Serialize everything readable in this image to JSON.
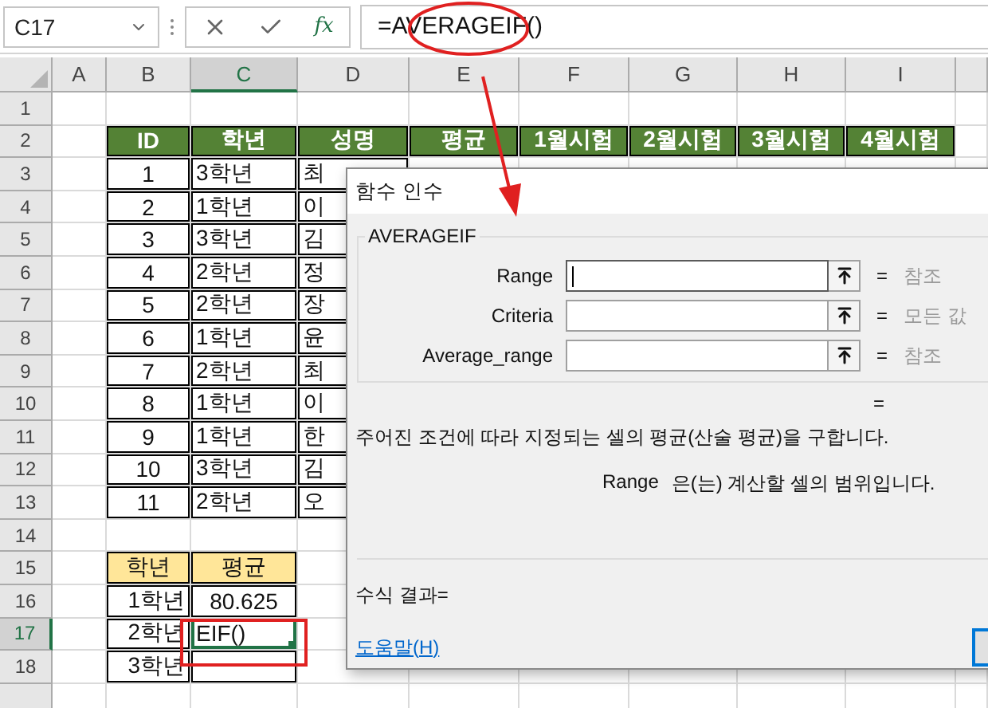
{
  "name_box": "C17",
  "function_button": "fx",
  "formula": "=AVERAGEIF()",
  "columns": [
    {
      "label": "A",
      "selected": false
    },
    {
      "label": "B",
      "selected": false
    },
    {
      "label": "C",
      "selected": true
    },
    {
      "label": "D",
      "selected": false
    },
    {
      "label": "E",
      "selected": false
    },
    {
      "label": "F",
      "selected": false
    },
    {
      "label": "G",
      "selected": false
    },
    {
      "label": "H",
      "selected": false
    },
    {
      "label": "I",
      "selected": false
    }
  ],
  "rows": [
    {
      "label": "1",
      "selected": false
    },
    {
      "label": "2",
      "selected": false
    },
    {
      "label": "3",
      "selected": false
    },
    {
      "label": "4",
      "selected": false
    },
    {
      "label": "5",
      "selected": false
    },
    {
      "label": "6",
      "selected": false
    },
    {
      "label": "7",
      "selected": false
    },
    {
      "label": "8",
      "selected": false
    },
    {
      "label": "9",
      "selected": false
    },
    {
      "label": "10",
      "selected": false
    },
    {
      "label": "11",
      "selected": false
    },
    {
      "label": "12",
      "selected": false
    },
    {
      "label": "13",
      "selected": false
    },
    {
      "label": "14",
      "selected": false
    },
    {
      "label": "15",
      "selected": false
    },
    {
      "label": "16",
      "selected": false
    },
    {
      "label": "17",
      "selected": true
    },
    {
      "label": "18",
      "selected": false
    }
  ],
  "main_table": {
    "columns": [
      "ID",
      "학년",
      "성명",
      "평균",
      "1월시험",
      "2월시험",
      "3월시험",
      "4월시험"
    ],
    "rows": [
      {
        "id": "1",
        "grade": "3학년",
        "name": "최"
      },
      {
        "id": "2",
        "grade": "1학년",
        "name": "이"
      },
      {
        "id": "3",
        "grade": "3학년",
        "name": "김"
      },
      {
        "id": "4",
        "grade": "2학년",
        "name": "정"
      },
      {
        "id": "5",
        "grade": "2학년",
        "name": "장"
      },
      {
        "id": "6",
        "grade": "1학년",
        "name": "윤"
      },
      {
        "id": "7",
        "grade": "2학년",
        "name": "최"
      },
      {
        "id": "8",
        "grade": "1학년",
        "name": "이"
      },
      {
        "id": "9",
        "grade": "1학년",
        "name": "한"
      },
      {
        "id": "10",
        "grade": "3학년",
        "name": "김"
      },
      {
        "id": "11",
        "grade": "2학년",
        "name": "오"
      }
    ]
  },
  "summary": {
    "columns": [
      "학년",
      "평균"
    ],
    "rows": [
      {
        "grade": "1학년",
        "average": "80.625",
        "editing": false
      },
      {
        "grade": "2학년",
        "average": "EIF()",
        "editing": true
      },
      {
        "grade": "3학년",
        "editing": false
      }
    ]
  },
  "dialog": {
    "title": "함수 인수",
    "function_name": "AVERAGEIF",
    "arguments": [
      {
        "label": "Range",
        "equals": "=",
        "hint": "참조",
        "focused": true
      },
      {
        "label": "Criteria",
        "equals": "=",
        "hint": "모든 값",
        "focused": false
      },
      {
        "label": "Average_range",
        "equals": "=",
        "hint": "참조",
        "focused": false
      }
    ],
    "result_equals": "=",
    "description": "주어진 조건에 따라 지정되는 셀의 평균(산술 평균)을 구합니다.",
    "argument_help": {
      "name": "Range",
      "text": "은(는) 계산할 셀의 범위입니다."
    },
    "formula_result": "수식 결과=",
    "help_link": "도움말(H)"
  }
}
